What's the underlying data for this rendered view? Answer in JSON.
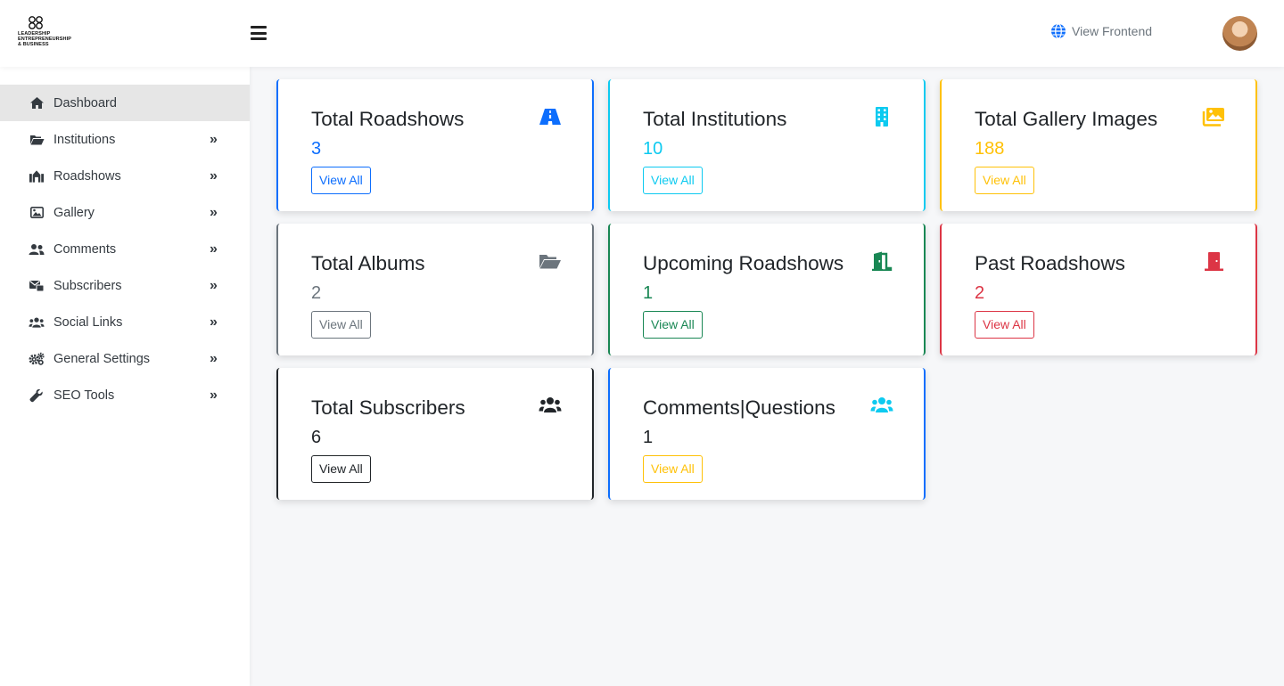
{
  "header": {
    "logo_text": [
      "LEADERSHIP",
      "ENTREPRENEURSHIP",
      "& BUSINESS"
    ],
    "view_frontend_label": "View Frontend",
    "icons": {
      "menu": "hamburger-icon",
      "globe": "globe-icon",
      "avatar": "user-avatar"
    }
  },
  "sidebar": {
    "items": [
      {
        "label": "Dashboard",
        "icon": "home-icon",
        "active": true
      },
      {
        "label": "Institutions",
        "icon": "folder-open-icon"
      },
      {
        "label": "Roadshows",
        "icon": "roadshows-icon"
      },
      {
        "label": "Gallery",
        "icon": "image-icon"
      },
      {
        "label": "Comments",
        "icon": "users-icon"
      },
      {
        "label": "Subscribers",
        "icon": "subscribers-icon"
      },
      {
        "label": "Social Links",
        "icon": "group-icon"
      },
      {
        "label": "General Settings",
        "icon": "gears-icon"
      },
      {
        "label": "SEO Tools",
        "icon": "wrench-icon"
      }
    ],
    "chevron": "»"
  },
  "cards": [
    {
      "title": "Total Roadshows",
      "value": "3",
      "button": "View All",
      "color": "#0d6efd",
      "icon": "road-icon"
    },
    {
      "title": "Total Institutions",
      "value": "10",
      "button": "View All",
      "color": "#0dcaf0",
      "icon": "building-icon"
    },
    {
      "title": "Total Gallery Images",
      "value": "188",
      "button": "View All",
      "color": "#ffc107",
      "icon": "images-icon"
    },
    {
      "title": "Total Albums",
      "value": "2",
      "button": "View All",
      "color": "#6c757d",
      "icon": "folder-open-icon"
    },
    {
      "title": "Upcoming Roadshows",
      "value": "1",
      "button": "View All",
      "color": "#198754",
      "icon": "door-open-icon"
    },
    {
      "title": "Past Roadshows",
      "value": "2",
      "button": "View All",
      "color": "#dc3545",
      "icon": "door-closed-icon"
    },
    {
      "title": "Total Subscribers",
      "value": "6",
      "button": "View All",
      "color": "#212529",
      "icon": "users-icon"
    },
    {
      "title": "Comments|Questions",
      "value": "1",
      "button": "View All",
      "color": "#0d6efd",
      "icon": "users-icon"
    }
  ],
  "colors": {
    "yellow_accent": "#ffc107",
    "dark_text": "#212529",
    "cyan_accent": "#0dcaf0"
  }
}
